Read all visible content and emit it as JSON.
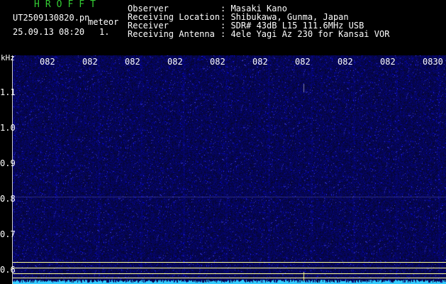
{
  "header": {
    "brand": "HROFFT",
    "filename": "UT2509130820.pn",
    "meteor_label": "meteor",
    "datetime": "25.09.13 08:20",
    "count": "1.",
    "fields": [
      {
        "label": "Observer",
        "value": ": Masaki Kano"
      },
      {
        "label": "Receiving Location",
        "value": ": Shibukawa, Gunma, Japan"
      },
      {
        "label": "Receiver",
        "value": ": SDR# 43dB L15 111.6MHz USB"
      },
      {
        "label": "Receiving Antenna",
        "value": ": 4ele Yagi Az 230 for Kansai VOR"
      }
    ]
  },
  "axis": {
    "unit": "kHz",
    "time_ticks": [
      "082",
      "082",
      "082",
      "082",
      "082",
      "082",
      "082",
      "082",
      "082",
      "0830"
    ],
    "freq_ticks": [
      "1.1",
      "1.0",
      "0.9",
      "0.8",
      "0.7",
      "0.6"
    ]
  },
  "colors": {
    "background": "#000000",
    "waterfall": "#0a0a4a",
    "brand": "#33cc33",
    "marker_line": "#ffff99",
    "signal": "#33ccff"
  }
}
